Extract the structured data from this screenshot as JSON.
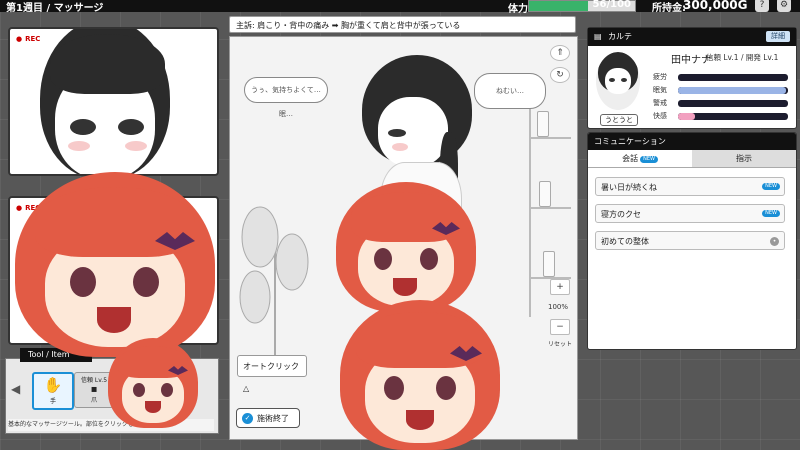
{
  "topbar": {
    "title": "第1週目 / マッサージ",
    "stamina_label": "体力:",
    "stamina_value": "56/100",
    "stamina_fraction": 0.56,
    "money_label": "所持金:",
    "money_value": "300,000G"
  },
  "rec_panels": {
    "top_label": "REC",
    "bottom_label": "REC"
  },
  "stage": {
    "subject_prefix": "主訴:",
    "subject": "肩こり・背中の痛み ➡ 胸が重くて肩と背中が張っている",
    "bubble_left": "うぅ、気持ちよくて…眠…",
    "bubble_right": "ねむい…",
    "zoom_plus": "+",
    "zoom_value": "100%",
    "zoom_minus": "−",
    "reset": "リセット",
    "autoclick": "オートクリック △",
    "finish": "施術終了"
  },
  "karte": {
    "header": "カルテ",
    "detail_button": "詳細",
    "name": "田中ナナ",
    "meta": "信頼 Lv.1 / 開発 Lv.1",
    "status_tag": "うとうと",
    "stats": [
      {
        "label": "疲労",
        "value": 0.0,
        "color": "#1c1c2e"
      },
      {
        "label": "眠気",
        "value": 0.98,
        "color": "#9ab4e6"
      },
      {
        "label": "警戒",
        "value": 0.0,
        "color": "#1c1c2e"
      },
      {
        "label": "快感",
        "value": 0.15,
        "color": "#f2a0c0"
      }
    ]
  },
  "communication": {
    "header": "コミュニケーション",
    "tab_talk": "会話",
    "tab_talk_badge": "NEW",
    "tab_order": "指示",
    "topics": [
      {
        "label": "暑い日が続くね",
        "badge": "NEW"
      },
      {
        "label": "寝方のクセ",
        "badge": "NEW"
      },
      {
        "label": "初めての整体",
        "badge": ""
      }
    ]
  },
  "tools": {
    "tab_label": "Tool / Item",
    "items": [
      {
        "label": "手",
        "level": ""
      },
      {
        "label": "爪",
        "level": "信頼 Lv.5"
      }
    ],
    "hint": "基本的なマッサージツール。部位をクリックして操作します。"
  }
}
